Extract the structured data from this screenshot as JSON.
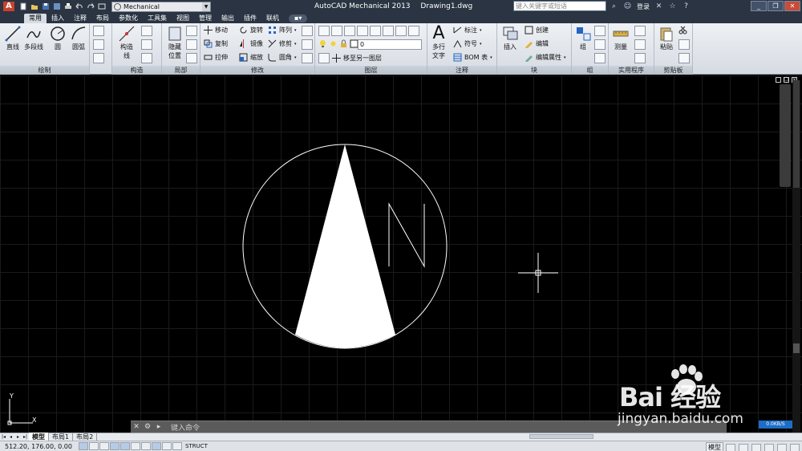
{
  "window": {
    "app_title": "AutoCAD Mechanical 2013",
    "file_name": "Drawing1.dwg",
    "workspace": "Mechanical",
    "search_placeholder": "键入关键字或短语",
    "login_label": "登录"
  },
  "tabs": [
    {
      "label": "常用",
      "active": true
    },
    {
      "label": "插入"
    },
    {
      "label": "注释"
    },
    {
      "label": "布局"
    },
    {
      "label": "参数化"
    },
    {
      "label": "工具集"
    },
    {
      "label": "视图"
    },
    {
      "label": "管理"
    },
    {
      "label": "输出"
    },
    {
      "label": "插件"
    },
    {
      "label": "联机"
    }
  ],
  "ribbon": {
    "draw": {
      "title": "绘制",
      "line": "直线",
      "polyline": "多段线",
      "circle": "圆",
      "arc": "圆弧"
    },
    "construct": {
      "title": "构造",
      "cline_1": "构造",
      "cline_2": "线"
    },
    "detail": {
      "title": "局部",
      "hide_1": "隐藏",
      "hide_2": "位置"
    },
    "modify": {
      "title": "修改",
      "move": "移动",
      "rotate": "旋转",
      "array": "阵列",
      "copy": "复制",
      "mirror": "镜像",
      "trim": "修剪",
      "stretch": "拉伸",
      "scale": "缩放",
      "fillet": "圆角"
    },
    "layers": {
      "title": "图层",
      "current_layer": "0",
      "move_to_layer": "移至另一图层"
    },
    "annotation": {
      "title": "注释",
      "mtext_1": "多行",
      "mtext_2": "文字",
      "dimension": "标注",
      "symbol": "符号",
      "bom": "BOM 表"
    },
    "block": {
      "title": "块",
      "insert": "插入",
      "create": "创建",
      "edit": "编辑",
      "edit_attr": "编辑属性"
    },
    "group": {
      "title": "组",
      "group": "组"
    },
    "utilities": {
      "title": "实用程序",
      "measure": "测量"
    },
    "clipboard": {
      "title": "剪贴板",
      "paste": "粘贴"
    }
  },
  "drawing": {
    "north_letter": "N"
  },
  "ucs": {
    "x_label": "X",
    "y_label": "Y"
  },
  "command_line": {
    "prompt": "键入命令"
  },
  "layout_tabs": [
    "模型",
    "布局1",
    "布局2"
  ],
  "status": {
    "coordinates": "512.20, 176.00, 0.00",
    "struct": "STRUCT",
    "model_label": "模型",
    "net_speed": "0.0KB/S"
  },
  "watermark": {
    "brand": "Bai 经验",
    "url": "jingyan.baidu.com"
  },
  "colors": {
    "titlebar": "#2a3442",
    "canvas": "#000000",
    "drawing_line": "#ffffff"
  }
}
